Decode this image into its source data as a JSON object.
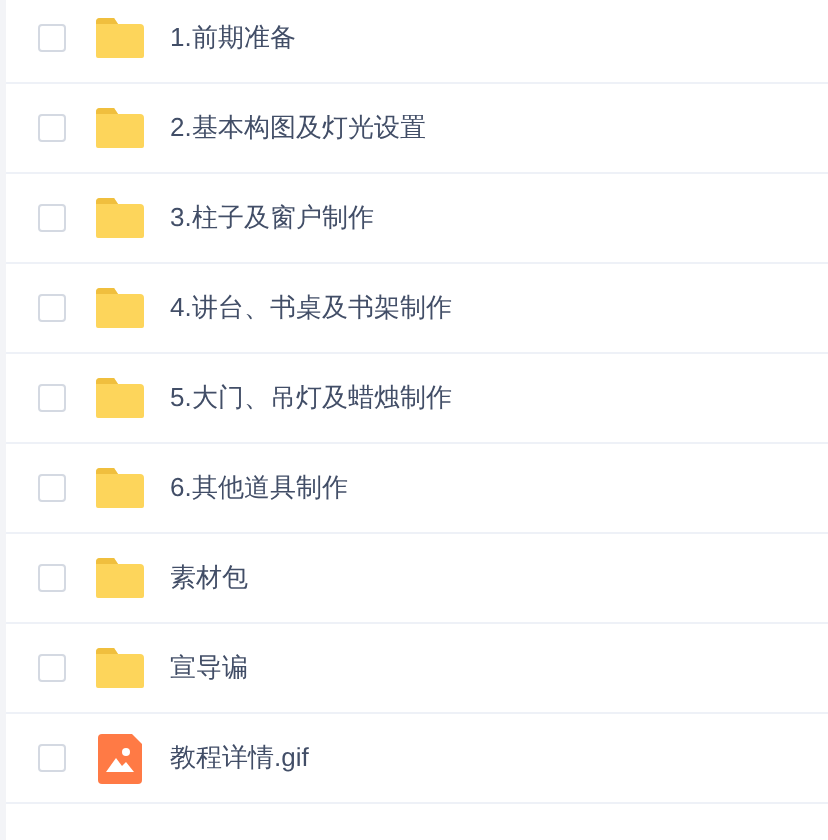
{
  "files": [
    {
      "kind": "folder",
      "name": "1.前期准备",
      "checked": false
    },
    {
      "kind": "folder",
      "name": "2.基本构图及灯光设置",
      "checked": false
    },
    {
      "kind": "folder",
      "name": "3.柱子及窗户制作",
      "checked": false
    },
    {
      "kind": "folder",
      "name": "4.讲台、书桌及书架制作",
      "checked": false
    },
    {
      "kind": "folder",
      "name": "5.大门、吊灯及蜡烛制作",
      "checked": false
    },
    {
      "kind": "folder",
      "name": "6.其他道具制作",
      "checked": false
    },
    {
      "kind": "folder",
      "name": "素材包",
      "checked": false
    },
    {
      "kind": "folder",
      "name": "宣导谝",
      "checked": false
    },
    {
      "kind": "image",
      "name": "教程详情.gif",
      "checked": false
    }
  ]
}
